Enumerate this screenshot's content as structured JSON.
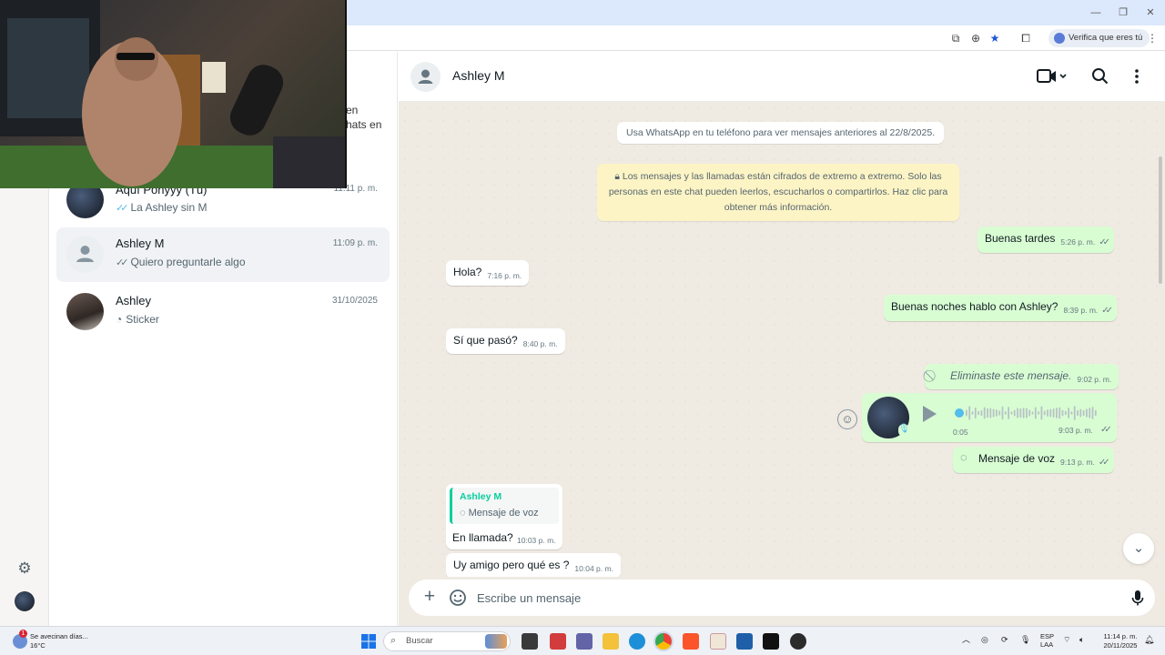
{
  "browser": {
    "verify_chip": "Verifica que eres tú",
    "icons": [
      "screen-share-icon",
      "zoom-icon",
      "star-icon",
      "extensions-icon",
      "more-vert-icon"
    ]
  },
  "chat_list": {
    "partial_header_a": "en",
    "partial_header_b": "hats en",
    "items": [
      {
        "name": "Aquí Ponyyy (Tú)",
        "time": "11:11 p. m.",
        "ticks": "read",
        "preview": "La Ashley sin M"
      },
      {
        "name": "Ashley M",
        "time": "11:09 p. m.",
        "ticks": "grey",
        "preview": "Quiero preguntarle algo"
      },
      {
        "name": "Ashley",
        "time": "31/10/2025",
        "ticks": "sticker",
        "preview": "Sticker"
      }
    ]
  },
  "chat": {
    "contact_name": "Ashley M",
    "system_note": "Usa WhatsApp en tu teléfono para ver mensajes anteriores al 22/8/2025.",
    "encryption_note_1": "Los mensajes y las llamadas están cifrados de extremo a extremo. Solo las",
    "encryption_note_2": "personas en este chat pueden leerlos, escucharlos o compartirlos. Haz clic para",
    "encryption_note_3": "obtener más información.",
    "messages": [
      {
        "dir": "out",
        "text": "Buenas tardes",
        "time": "5:26 p. m."
      },
      {
        "dir": "in",
        "text": "Hola?",
        "time": "7:16 p. m."
      },
      {
        "dir": "out",
        "text": "Buenas noches hablo con Ashley?",
        "time": "8:39 p. m."
      },
      {
        "dir": "in",
        "text": "Sí que pasó?",
        "time": "8:40 p. m."
      },
      {
        "dir": "out",
        "text": "Eliminaste este mensaje.",
        "time": "9:02 p. m."
      },
      {
        "dir": "out",
        "text": "0:05",
        "time": "9:03 p. m."
      },
      {
        "dir": "out",
        "text": "Mensaje de voz",
        "time": "9:13 p. m."
      },
      {
        "dir": "in",
        "quote_author": "Ashley M",
        "quote_text": "Mensaje de voz",
        "text": "En llamada?",
        "time": "10:03 p. m."
      },
      {
        "dir": "in",
        "text": "Uy amigo pero qué es ?",
        "time": "10:04 p. m."
      }
    ],
    "voice_progress": 0.0,
    "composer_placeholder": "Escribe un mensaje"
  },
  "taskbar": {
    "weather_line1": "Se avecinan días...",
    "weather_line2": "16°C",
    "weather_badge": "1",
    "search_placeholder": "Buscar",
    "lang_line1": "ESP",
    "lang_line2": "LAA",
    "clock_time": "11:14 p. m.",
    "clock_date": "20/11/2025"
  },
  "colors": {
    "outgoing_bubble": "#d9fdd3",
    "incoming_bubble": "#ffffff",
    "chat_background": "#efeae2",
    "read_ticks": "#53bdeb",
    "accent_green": "#06cf9c"
  }
}
